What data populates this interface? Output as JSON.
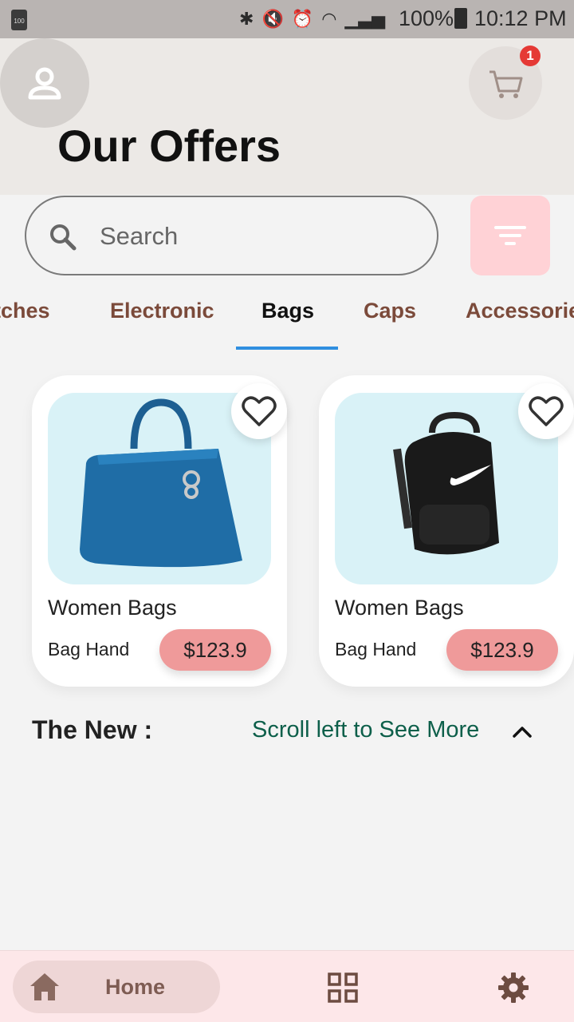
{
  "status_bar": {
    "left_battery_text": "100",
    "battery_percent": "100%",
    "time": "10:12 PM"
  },
  "header": {
    "title": "Our Offers",
    "cart_count": "1"
  },
  "search": {
    "placeholder": "Search"
  },
  "categories": {
    "tabs": [
      "tches",
      "Electronic",
      "Bags",
      "Caps",
      "Accessorie"
    ],
    "selected": "Bags"
  },
  "products": [
    {
      "name": "Women Bags",
      "subtitle": "Bag Hand",
      "price": "$123.9",
      "image": "blue-handbag"
    },
    {
      "name": "Women Bags",
      "subtitle": "Bag Hand",
      "price": "$123.9",
      "image": "black-backpack"
    }
  ],
  "section": {
    "title": "The New :",
    "scroll_hint": "Scroll left to See More"
  },
  "bottom_nav": {
    "home_label": "Home"
  },
  "colors": {
    "accent_underline": "#2f8fe0",
    "price_pill": "#ef9a9a",
    "filter_button": "#ffd2d6",
    "scroll_hint": "#0d5f4a",
    "tab_text": "#7b4a3a"
  },
  "icons": [
    "user-icon",
    "cart-icon",
    "search-icon",
    "filter-icon",
    "heart-icon",
    "chevron-up-icon",
    "home-icon",
    "grid-icon",
    "gear-icon"
  ]
}
